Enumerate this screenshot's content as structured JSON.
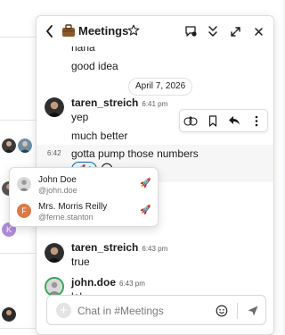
{
  "channel": {
    "name": "Meetings"
  },
  "date_divider": "April 7, 2026",
  "messages": [
    {
      "text": "nana"
    },
    {
      "text": "good idea"
    },
    {
      "author": "taren_streich",
      "time": "6:41 pm",
      "text": "yep"
    },
    {
      "text": "much better"
    },
    {
      "gutter_time": "6:42",
      "text": "gotta pump those numbers",
      "reaction": {
        "emoji": "🚀",
        "count": "2"
      }
    },
    {
      "author": "taren_streich",
      "time": "6:43 pm",
      "text": "true"
    },
    {
      "author": "john.doe",
      "time": "6:43 pm",
      "text": "lol"
    }
  ],
  "reaction_popup": {
    "users": [
      {
        "name": "John Doe",
        "handle": "@john.doe",
        "emoji": "🚀"
      },
      {
        "name": "Mrs. Morris Reilly",
        "handle": "@ferne.stanton",
        "emoji": "🚀",
        "initial": "F"
      }
    ]
  },
  "background": {
    "avatar_initial": "K"
  },
  "composer": {
    "placeholder": "Chat in #Meetings"
  },
  "colors": {
    "accent": "#1264a3",
    "orange_avatar": "#d97a47",
    "purple_avatar": "#b08cd8"
  },
  "icons": {
    "header": [
      "back-icon",
      "briefcase-icon",
      "star-icon",
      "bubble-settings-icon",
      "chevron-collapse-icon",
      "expand-icon",
      "close-icon"
    ],
    "message_actions": [
      "add-reaction-icon",
      "bookmark-icon",
      "reply-icon",
      "more-icon"
    ]
  }
}
